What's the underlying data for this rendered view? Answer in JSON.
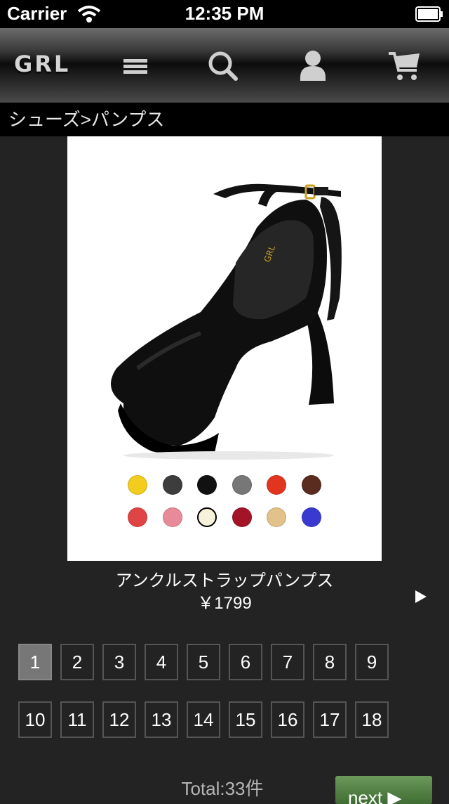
{
  "status_bar": {
    "carrier": "Carrier",
    "time": "12:35 PM"
  },
  "nav": {
    "logo": "GRL",
    "icons": [
      "menu-icon",
      "search-icon",
      "user-icon",
      "cart-icon"
    ]
  },
  "breadcrumb": "シューズ>パンプス",
  "product": {
    "name": "アンクルストラップパンプス",
    "price": "￥1799",
    "swatches": [
      [
        "#f2cd1f",
        "#3d3d3d",
        "#111111",
        "#777777",
        "#e2351f",
        "#5a2c20"
      ],
      [
        "#e04545",
        "#e88a98",
        "#f6f2dc",
        "#a31426",
        "#e3c18a",
        "#3a3ad0"
      ]
    ],
    "selected_swatch": "#f6f2dc"
  },
  "pagination": {
    "pages": [
      "1",
      "2",
      "3",
      "4",
      "5",
      "6",
      "7",
      "8",
      "9",
      "10",
      "11",
      "12",
      "13",
      "14",
      "15",
      "16",
      "17",
      "18"
    ],
    "current": "1"
  },
  "total": "Total:33件",
  "next_label": "next ▶"
}
